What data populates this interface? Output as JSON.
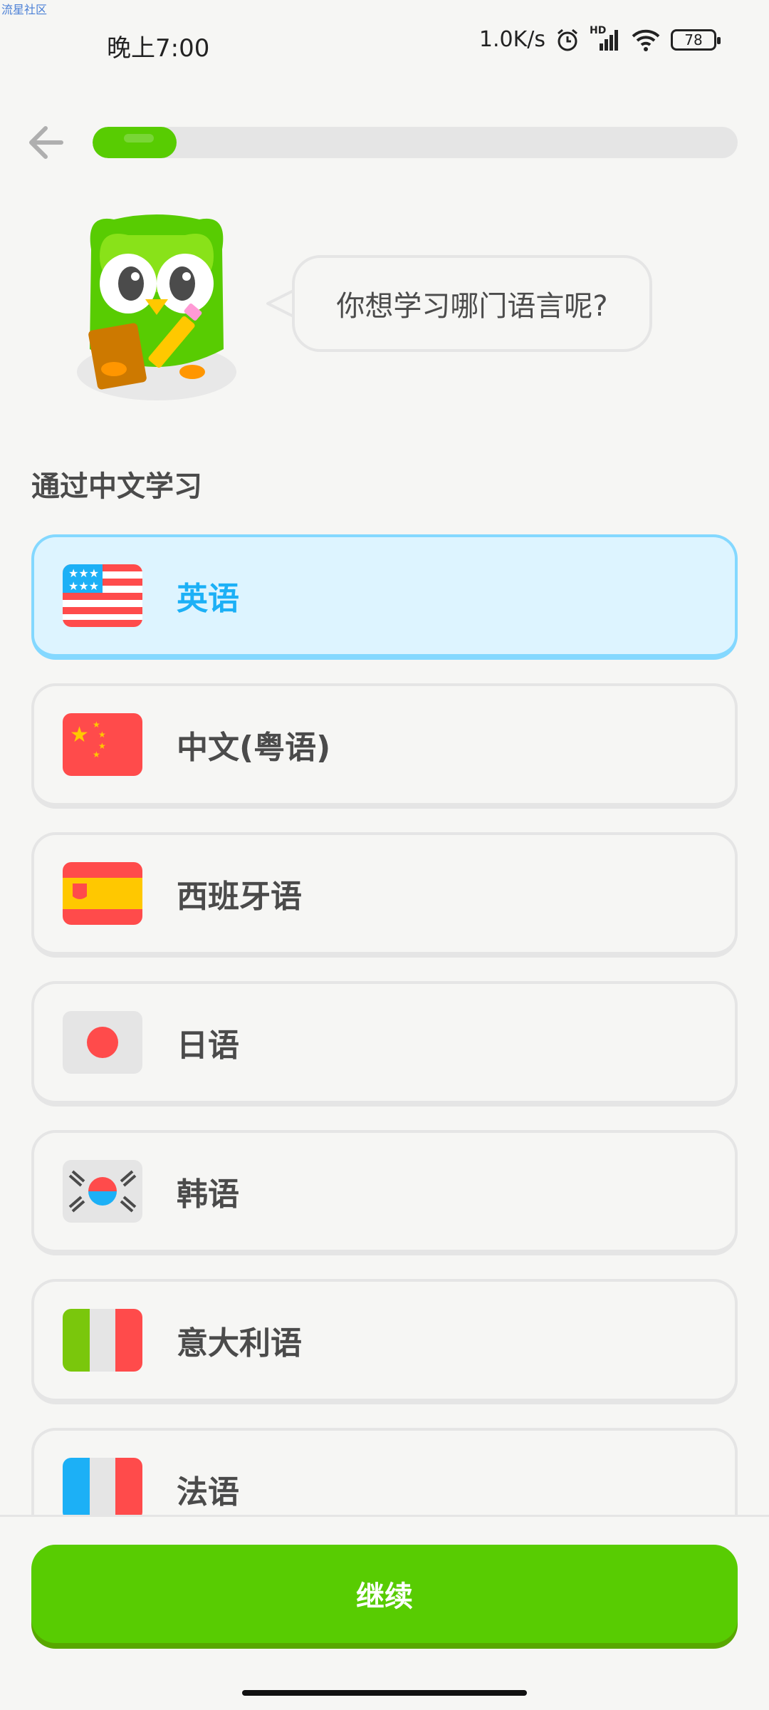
{
  "watermark": "流星社区",
  "status_bar": {
    "time": "晚上7:00",
    "net_speed": "1.0K/s",
    "network_tag": "HD",
    "battery": "78"
  },
  "progress": {
    "value": 0.13
  },
  "bubble": {
    "text": "你想学习哪门语言呢?"
  },
  "section": {
    "title": "通过中文学习"
  },
  "options": [
    {
      "label": "英语",
      "flag": "us-flag-icon",
      "selected": true
    },
    {
      "label": "中文(粤语)",
      "flag": "china-flag-icon",
      "selected": false
    },
    {
      "label": "西班牙语",
      "flag": "spain-flag-icon",
      "selected": false
    },
    {
      "label": "日语",
      "flag": "japan-flag-icon",
      "selected": false
    },
    {
      "label": "韩语",
      "flag": "korea-flag-icon",
      "selected": false
    },
    {
      "label": "意大利语",
      "flag": "italy-flag-icon",
      "selected": false
    },
    {
      "label": "法语",
      "flag": "france-flag-icon",
      "selected": false
    }
  ],
  "continue_button": {
    "label": "继续"
  },
  "colors": {
    "brand_green": "#58cc02",
    "selected_blue": "#1cb0f6",
    "selected_bg": "#ddf4ff"
  }
}
